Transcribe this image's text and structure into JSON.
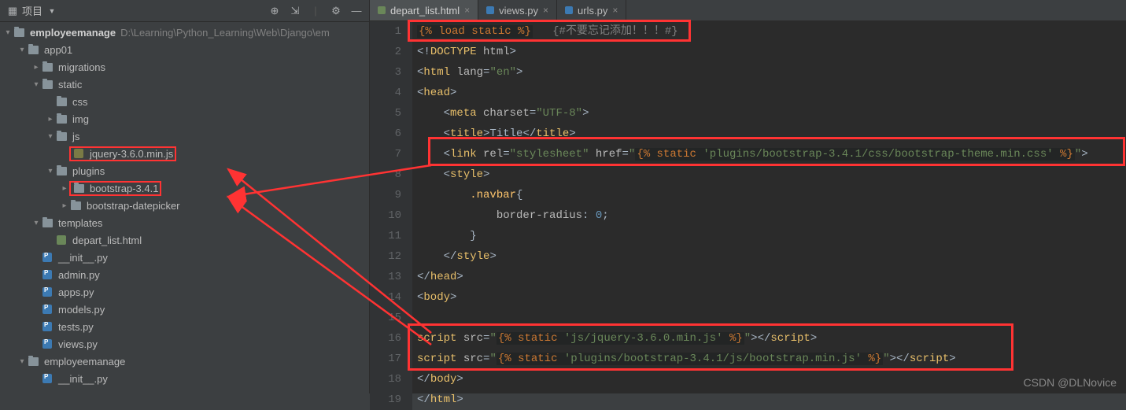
{
  "sidebar": {
    "title": "项目",
    "toolbar_icons": [
      "target",
      "expand",
      "divider",
      "gear",
      "hide"
    ],
    "root": {
      "name": "employeemanage",
      "path": "D:\\Learning\\Python_Learning\\Web\\Django\\em"
    },
    "tree": [
      {
        "indent": 1,
        "arrow": "v",
        "icon": "folder",
        "label": "app01"
      },
      {
        "indent": 2,
        "arrow": ">",
        "icon": "folder",
        "label": "migrations"
      },
      {
        "indent": 2,
        "arrow": "v",
        "icon": "folder",
        "label": "static"
      },
      {
        "indent": 3,
        "arrow": "",
        "icon": "folder",
        "label": "css"
      },
      {
        "indent": 3,
        "arrow": ">",
        "icon": "folder",
        "label": "img"
      },
      {
        "indent": 3,
        "arrow": "v",
        "icon": "folder",
        "label": "js"
      },
      {
        "indent": 4,
        "arrow": "",
        "icon": "jsfile",
        "label": "jquery-3.6.0.min.js",
        "highlight": true
      },
      {
        "indent": 3,
        "arrow": "v",
        "icon": "folder",
        "label": "plugins"
      },
      {
        "indent": 4,
        "arrow": ">",
        "icon": "folder",
        "label": "bootstrap-3.4.1",
        "highlight": true
      },
      {
        "indent": 4,
        "arrow": ">",
        "icon": "folder",
        "label": "bootstrap-datepicker"
      },
      {
        "indent": 2,
        "arrow": "v",
        "icon": "folder",
        "label": "templates"
      },
      {
        "indent": 3,
        "arrow": "",
        "icon": "htmlfile",
        "label": "depart_list.html"
      },
      {
        "indent": 2,
        "arrow": "",
        "icon": "pyfile",
        "label": "__init__.py"
      },
      {
        "indent": 2,
        "arrow": "",
        "icon": "pyfile",
        "label": "admin.py"
      },
      {
        "indent": 2,
        "arrow": "",
        "icon": "pyfile",
        "label": "apps.py"
      },
      {
        "indent": 2,
        "arrow": "",
        "icon": "pyfile",
        "label": "models.py"
      },
      {
        "indent": 2,
        "arrow": "",
        "icon": "pyfile",
        "label": "tests.py"
      },
      {
        "indent": 2,
        "arrow": "",
        "icon": "pyfile",
        "label": "views.py"
      },
      {
        "indent": 1,
        "arrow": "v",
        "icon": "folder",
        "label": "employeemanage"
      },
      {
        "indent": 2,
        "arrow": "",
        "icon": "pyfile",
        "label": "__init__.py"
      }
    ]
  },
  "tabs": [
    {
      "label": "depart_list.html",
      "icon_color": "#6a8759",
      "active": true
    },
    {
      "label": "views.py",
      "icon_color": "#3c7ab3",
      "active": false
    },
    {
      "label": "urls.py",
      "icon_color": "#3c7ab3",
      "active": false
    }
  ],
  "code": {
    "lines": [
      {
        "n": 1,
        "html": "<span class='djtag'>{% <span class='kw'>load</span> static %}</span>   <span class='cmt'>{#不要忘记添加！！！#}</span>"
      },
      {
        "n": 2,
        "html": "&lt;!<span class='tag'>DOCTYPE</span> <span class='attr'>html</span>&gt;"
      },
      {
        "n": 3,
        "html": "&lt;<span class='tag'>html</span> <span class='attr'>lang</span>=<span class='str'>\"en\"</span>&gt;"
      },
      {
        "n": 4,
        "html": "&lt;<span class='tag'>head</span>&gt;"
      },
      {
        "n": 5,
        "html": "    &lt;<span class='tag'>meta</span> <span class='attr'>charset</span>=<span class='str'>\"UTF-8\"</span>&gt;"
      },
      {
        "n": 6,
        "html": "    &lt;<span class='tag'>title</span>&gt;Title&lt;/<span class='tag'>title</span>&gt;"
      },
      {
        "n": 7,
        "html": "    &lt;<span class='tag'>link</span> <span class='attr'>rel</span>=<span class='str'>\"stylesheet\"</span> <span class='attr'>href</span>=<span class='str'>\"</span><span class='djtag'>{% <span class='kw'>static</span> <span class='djstr'>'plugins/bootstrap-3.4.1/css/bootstrap-theme.min.css'</span> %}</span><span class='str'>\"</span>&gt;"
      },
      {
        "n": 8,
        "html": "    &lt;<span class='tag'>style</span>&gt;"
      },
      {
        "n": 9,
        "html": "        <span class='yel'>.navbar</span>{"
      },
      {
        "n": 10,
        "html": "            <span class='attr'>border-radius</span>: <span class='num'>0</span>;"
      },
      {
        "n": 11,
        "html": "        }"
      },
      {
        "n": 12,
        "html": "    &lt;/<span class='tag'>style</span>&gt;"
      },
      {
        "n": 13,
        "html": "&lt;/<span class='tag'>head</span>&gt;"
      },
      {
        "n": 14,
        "html": "&lt;<span class='tag'>body</span>&gt;"
      },
      {
        "n": 15,
        "html": ""
      },
      {
        "n": 16,
        "html": "<span class='tag'>script</span> <span class='attr'>src</span>=<span class='str'>\"</span><span class='djtag'>{% <span class='kw'>static</span> <span class='djstr'>'js/jquery-3.6.0.min.js'</span> %}</span><span class='str'>\"</span>&gt;&lt;/<span class='tag'>script</span>&gt;"
      },
      {
        "n": 17,
        "html": "<span class='tag'>script</span> <span class='attr'>src</span>=<span class='str'>\"</span><span class='djtag'>{% <span class='kw'>static</span> <span class='djstr'>'plugins/bootstrap-3.4.1/js/bootstrap.min.js'</span> %}</span><span class='str'>\"</span>&gt;&lt;/<span class='tag'>script</span>&gt;"
      },
      {
        "n": 18,
        "html": "&lt;/<span class='tag'>body</span>&gt;"
      },
      {
        "n": 19,
        "html": "&lt;/<span class='tag'>html</span>&gt;"
      }
    ]
  },
  "watermark": "CSDN @DLNovice"
}
